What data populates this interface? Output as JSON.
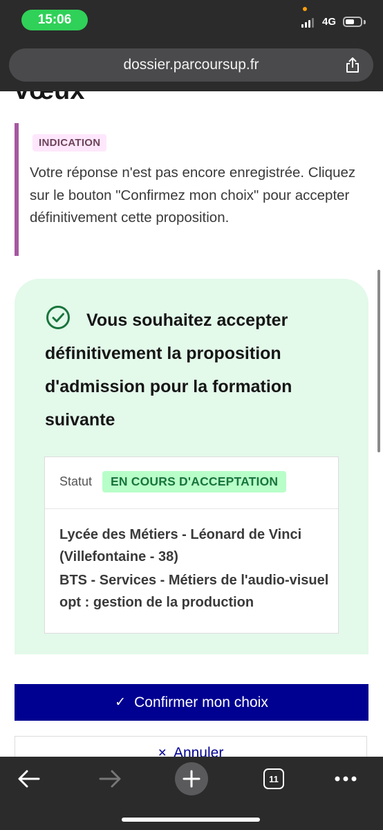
{
  "status_bar": {
    "time": "15:06",
    "network": "4G"
  },
  "browser": {
    "url": "dossier.parcoursup.fr",
    "tab_count": "11"
  },
  "page": {
    "heading_fragment": "vœux"
  },
  "indication": {
    "badge": "INDICATION",
    "text": "Votre réponse n'est pas encore enregistrée. Cliquez sur le bouton \"Confirmez mon choix\" pour accepter définitivement cette proposition."
  },
  "card": {
    "title": "Vous souhaitez accepter définitivement la proposition d'admission pour la formation suivante",
    "statut_label": "Statut",
    "status_badge": "EN COURS D'ACCEPTATION",
    "school": "Lycée des Métiers - Léonard de Vinci (Villefontaine - 38)",
    "program": "BTS - Services - Métiers de l'audio-visuel opt : gestion de la production"
  },
  "actions": {
    "confirm_label": "Confirmer mon choix",
    "cancel_label": "Annuler"
  },
  "colors": {
    "primary": "#000091",
    "success_bg": "#e3f9ea",
    "indication_border": "#a558a0",
    "status_green": "#18753c"
  },
  "icons": [
    "share-icon",
    "check-circle-icon",
    "checkmark-icon",
    "close-icon",
    "back-arrow-icon",
    "forward-arrow-icon",
    "plus-icon",
    "tabs-icon",
    "more-icon"
  ]
}
